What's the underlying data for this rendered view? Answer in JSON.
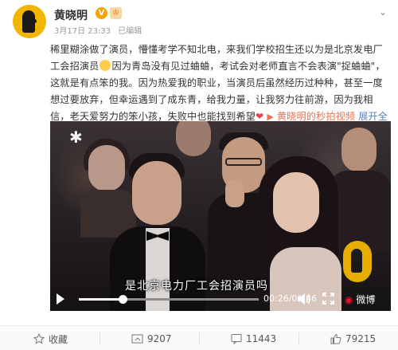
{
  "post": {
    "author": "黄晓明",
    "verified_mark": "V",
    "level_mark": "♔",
    "date": "3月17日 23:33",
    "source": "已编辑",
    "more": "⌄",
    "text": {
      "p1": "稀里糊涂做了演员，懵懂考学不知北电，来我们学校招生还以为是北京发电厂工会招演员",
      "p2": "因为青岛没有见过蛐蛐，考试会对老师直言不会表演",
      "link1": "\"捉蛐蛐\"",
      "p3": "，这就是有点笨的我。因为热爱我的职业，当演员后虽然经历过种种，甚至一度想过要放弃，但幸运遇到了成东青，给我力量，让我努力往前游，因为我相信，老天爱努力的笨小孩，失败中也能找到希望",
      "heart": "❤",
      "video_link": "黄晓明的秒拍视频",
      "expand": "展开全文",
      "expand_arrow": "⌄"
    }
  },
  "video": {
    "subtitle": "是北京电力厂工会招演员吗",
    "time": "00:26/01:46",
    "progress": 0.245,
    "brand": "微博",
    "star": "✱"
  },
  "actions": {
    "favorite": "收藏",
    "repost": "9207",
    "comment": "11443",
    "like": "79215"
  },
  "colors": {
    "link_orange": "#eb7350",
    "link_blue": "#5d84b5",
    "badge_gold": "#f6a300",
    "avatar_yellow": "#f2b600"
  }
}
